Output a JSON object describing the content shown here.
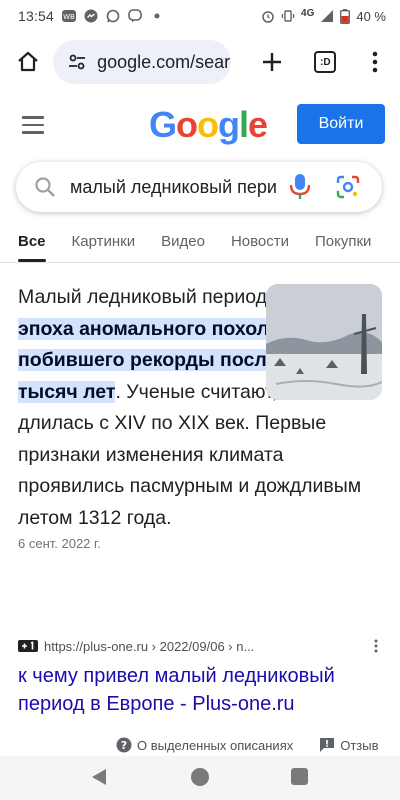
{
  "status_bar": {
    "time": "13:54",
    "network": "4G",
    "battery": "40 %",
    "icons": [
      "wb-notification-icon",
      "messenger-icon",
      "whatsapp-icon",
      "viber-icon",
      "dot-icon",
      "alarm-icon",
      "vibrate-icon",
      "signal-icon",
      "battery-icon"
    ]
  },
  "browser": {
    "url": "google.com/search",
    "tab_count": ":D",
    "icons": [
      "home-icon",
      "tune-icon",
      "plus-icon",
      "tabs-icon",
      "more-vert-icon"
    ]
  },
  "header": {
    "logo": "Google",
    "logo_colors": [
      "#4285F4",
      "#EA4335",
      "#FBBC05",
      "#4285F4",
      "#34A853",
      "#EA4335"
    ],
    "login_label": "Войти",
    "accent": "#1a73e8"
  },
  "search": {
    "query": "малый ледниковый период"
  },
  "tabs": [
    {
      "label": "Все",
      "active": true
    },
    {
      "label": "Картинки",
      "active": false
    },
    {
      "label": "Видео",
      "active": false
    },
    {
      "label": "Новости",
      "active": false
    },
    {
      "label": "Покупки",
      "active": false
    }
  ],
  "snippet": {
    "text_before": "Малый ледниковый период — это ",
    "highlight": "эпоха аномального похолодания, побившего рекорды последних двух тысяч лет",
    "text_after": ". Ученые считают, что она длилась с XIV по XIX век. Первые признаки изменения климата проявились пасмурным и дождливым летом 1312 года.",
    "date": "6 сент. 2022 г."
  },
  "result": {
    "url": "https://plus-one.ru › 2022/09/06 › n...",
    "title": "к чему привел малый ледниковый период в Европе - Plus-one.ru"
  },
  "footer": {
    "about_label": "О выделенных описаниях",
    "feedback_label": "Отзыв"
  }
}
